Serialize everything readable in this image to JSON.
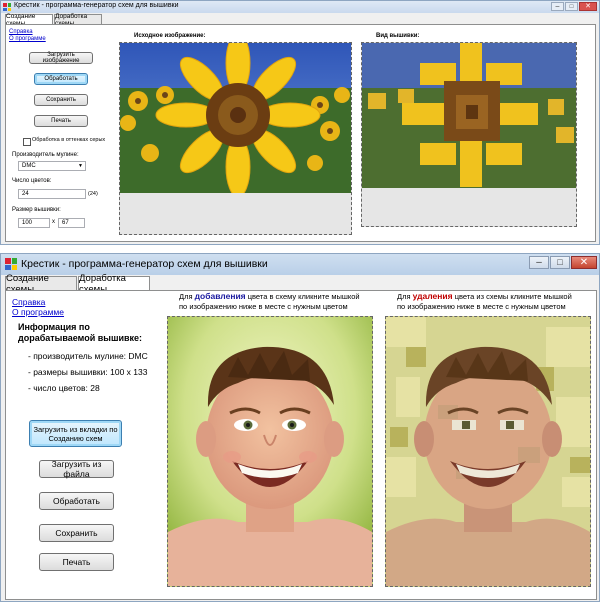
{
  "top_window": {
    "title": "Крестик - программа-генератор схем для вышивки",
    "tabs": [
      "Создание схемы",
      "Доработка схемы"
    ],
    "links": [
      "Справка",
      "О программе"
    ],
    "buttons": {
      "load": "Загрузить изображение",
      "process": "Обработать",
      "save": "Сохранить",
      "print": "Печать"
    },
    "shades_checkbox": "Обработка в оттенках серых",
    "manufacturer_label": "Производитель мулине:",
    "manufacturer_value": "DMC",
    "colors_label": "Число цветов:",
    "colors_value": "24",
    "colors_result": "(24)",
    "size_label": "Размер вышивки:",
    "size_w": "100",
    "size_x": "x",
    "size_h": "67",
    "source_caption": "Исходное изображение:",
    "result_caption": "Вид вышивки:"
  },
  "bottom_window": {
    "title": "Крестик - программа-генератор схем для вышивки",
    "tabs": [
      "Создание схемы",
      "Доработка схемы"
    ],
    "links": [
      "Справка",
      "О программе"
    ],
    "info_title": "Информация по дорабатываемой вышивке:",
    "info_lines": [
      "- производитель мулине: DMC",
      "- размеры вышивки: 100 x 133",
      "- число цветов: 28"
    ],
    "buttons": {
      "load_from_tab": "Загрузить из вкладки по Созданию схем",
      "load_file": "Загрузить из файла",
      "process": "Обработать",
      "save": "Сохранить",
      "print": "Печать"
    },
    "add_hint": {
      "pre": "Для",
      "word": "добавления",
      "post": "цвета в схему кликните мышкой",
      "line2": "по изображению ниже в месте с нужным цветом"
    },
    "remove_hint": {
      "pre": "Для",
      "word": "удаления",
      "post": "цвета из схемы кликните мышкой",
      "line2": "по изображению ниже в месте с нужным цветом"
    }
  },
  "colors": {
    "add_word": "#1a1aa0",
    "remove_word": "#c00000",
    "link": "#0000cc"
  },
  "icons": {
    "app": "cross-stitch-grid-icon",
    "minimize": "minimize-icon",
    "maximize": "maximize-icon",
    "close": "close-icon",
    "dropdown": "chevron-down-icon"
  }
}
